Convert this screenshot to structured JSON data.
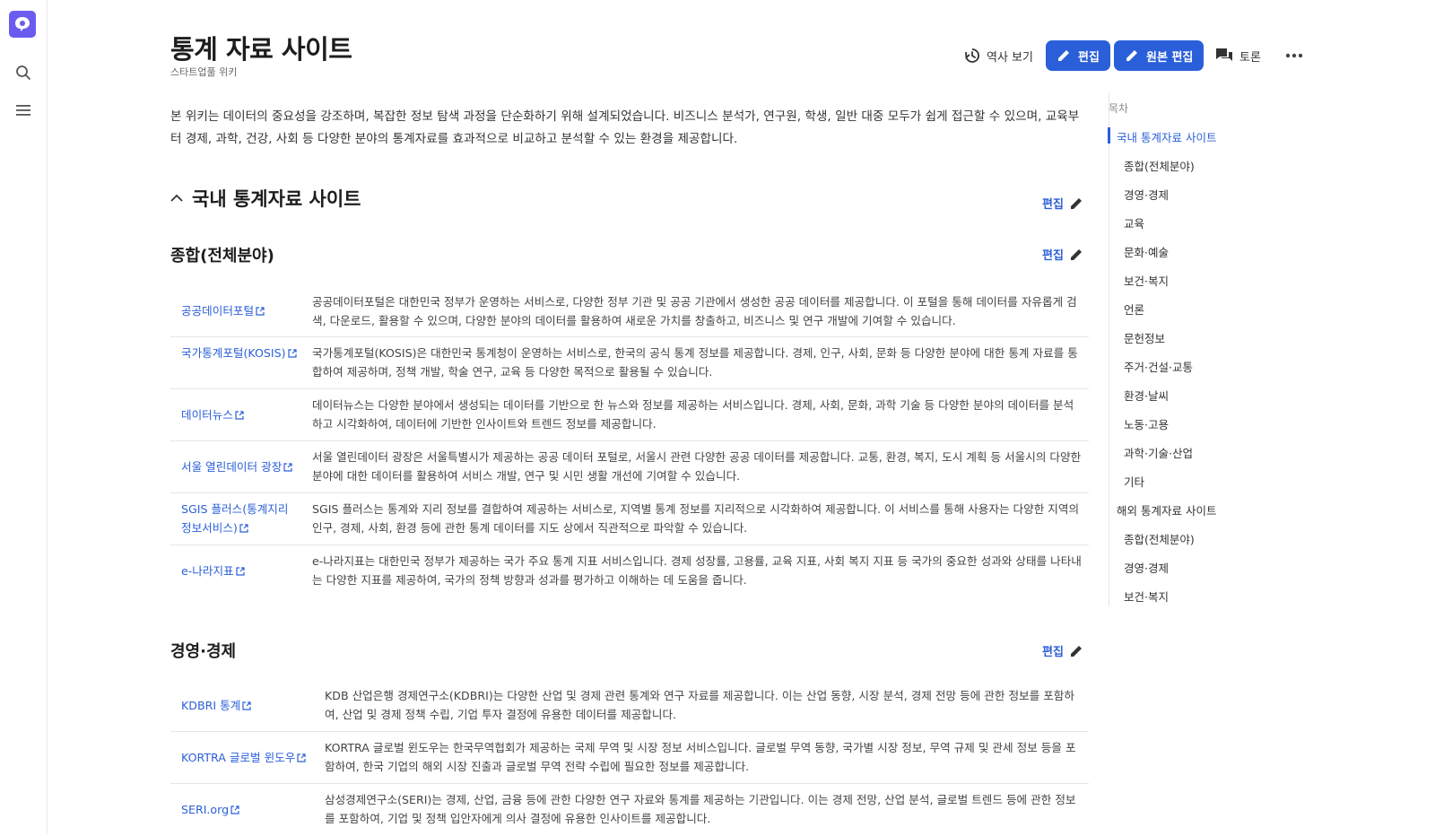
{
  "app": {
    "accent": "#2b5fd9",
    "logo_color": "#6b5cf0"
  },
  "rail": {
    "icons": [
      "logo-icon",
      "search-icon",
      "menu-icon"
    ]
  },
  "page": {
    "title": "통계 자료 사이트",
    "subtitle": "스타트업풀 위키"
  },
  "toolbar": {
    "history": "역사 보기",
    "edit": "편집",
    "source_edit": "원본 편집",
    "talk": "토론"
  },
  "intro": "본 위키는 데이터의 중요성을 강조하며, 복잡한 정보 탐색 과정을 단순화하기 위해 설계되었습니다. 비즈니스 분석가, 연구원, 학생, 일반 대중 모두가 쉽게 접근할 수 있으며, 교육부터 경제, 과학, 건강, 사회 등 다양한 분야의 통계자료를 효과적으로 비교하고 분석할 수 있는 환경을 제공합니다.",
  "section": {
    "title": "국내 통계자료 사이트",
    "edit": "편집"
  },
  "general": {
    "title": "종합(전체분야)",
    "edit": "편집",
    "rows": [
      {
        "name": "공공데이터포털",
        "desc": "공공데이터포털은 대한민국 정부가 운영하는 서비스로, 다양한 정부 기관 및 공공 기관에서 생성한 공공 데이터를 제공합니다. 이 포털을 통해 데이터를 자유롭게 검색, 다운로드, 활용할 수 있으며, 다양한 분야의 데이터를 활용하여 새로운 가치를 창출하고, 비즈니스 및 연구 개발에 기여할 수 있습니다."
      },
      {
        "name": "국가통계포털(KOSIS)",
        "desc": "국가통계포털(KOSIS)은 대한민국 통계청이 운영하는 서비스로, 한국의 공식 통계 정보를 제공합니다. 경제, 인구, 사회, 문화 등 다양한 분야에 대한 통계 자료를 통합하여 제공하며, 정책 개발, 학술 연구, 교육 등 다양한 목적으로 활용될 수 있습니다."
      },
      {
        "name": "데이터뉴스",
        "desc": "데이터뉴스는 다양한 분야에서 생성되는 데이터를 기반으로 한 뉴스와 정보를 제공하는 서비스입니다. 경제, 사회, 문화, 과학 기술 등 다양한 분야의 데이터를 분석하고 시각화하여, 데이터에 기반한 인사이트와 트렌드 정보를 제공합니다."
      },
      {
        "name": "서울 열린데이터 광장",
        "desc": "서울 열린데이터 광장은 서울특별시가 제공하는 공공 데이터 포털로, 서울시 관련 다양한 공공 데이터를 제공합니다. 교통, 환경, 복지, 도시 계획 등 서울시의 다양한 분야에 대한 데이터를 활용하여 서비스 개발, 연구 및 시민 생활 개선에 기여할 수 있습니다."
      },
      {
        "name": "SGIS 플러스(통계지리정보서비스)",
        "desc": "SGIS 플러스는 통계와 지리 정보를 결합하여 제공하는 서비스로, 지역별 통계 정보를 지리적으로 시각화하여 제공합니다. 이 서비스를 통해 사용자는 다양한 지역의 인구, 경제, 사회, 환경 등에 관한 통계 데이터를 지도 상에서 직관적으로 파악할 수 있습니다."
      },
      {
        "name": "e-나라지표",
        "desc": "e-나라지표는 대한민국 정부가 제공하는 국가 주요 통계 지표 서비스입니다. 경제 성장률, 고용률, 교육 지표, 사회 복지 지표 등 국가의 중요한 성과와 상태를 나타내는 다양한 지표를 제공하여, 국가의 정책 방향과 성과를 평가하고 이해하는 데 도움을 줍니다."
      }
    ]
  },
  "economy": {
    "title": "경영·경제",
    "edit": "편집",
    "rows": [
      {
        "name": "KDBRI 통계",
        "desc": "KDB 산업은행 경제연구소(KDBRI)는 다양한 산업 및 경제 관련 통계와 연구 자료를 제공합니다. 이는 산업 동향, 시장 분석, 경제 전망 등에 관한 정보를 포함하여, 산업 및 경제 정책 수립, 기업 투자 결정에 유용한 데이터를 제공합니다."
      },
      {
        "name": "KORTRA 글로벌 윈도우",
        "desc": "KORTRA 글로벌 윈도우는 한국무역협회가 제공하는 국제 무역 및 시장 정보 서비스입니다. 글로벌 무역 동향, 국가별 시장 정보, 무역 규제 및 관세 정보 등을 포함하여, 한국 기업의 해외 시장 진출과 글로벌 무역 전략 수립에 필요한 정보를 제공합니다."
      },
      {
        "name": "SERI.org",
        "desc": "삼성경제연구소(SERI)는 경제, 산업, 금융 등에 관한 다양한 연구 자료와 통계를 제공하는 기관입니다. 이는 경제 전망, 산업 분석, 글로벌 트렌드 등에 관한 정보를 포함하여, 기업 및 정책 입안자에게 의사 결정에 유용한 인사이트를 제공합니다."
      }
    ]
  },
  "toc": {
    "title": "목차",
    "items": [
      {
        "label": "국내 통계자료 사이트",
        "level": 1,
        "active": true
      },
      {
        "label": "종합(전체분야)",
        "level": 2
      },
      {
        "label": "경영·경제",
        "level": 2
      },
      {
        "label": "교육",
        "level": 2
      },
      {
        "label": "문화·예술",
        "level": 2
      },
      {
        "label": "보건·복지",
        "level": 2
      },
      {
        "label": "언론",
        "level": 2
      },
      {
        "label": "문헌정보",
        "level": 2
      },
      {
        "label": "주거·건설·교통",
        "level": 2
      },
      {
        "label": "환경·날씨",
        "level": 2
      },
      {
        "label": "노동·고용",
        "level": 2
      },
      {
        "label": "과학·기술·산업",
        "level": 2
      },
      {
        "label": "기타",
        "level": 2
      },
      {
        "label": "해외 통계자료 사이트",
        "level": 1
      },
      {
        "label": "종합(전체분야)",
        "level": 2
      },
      {
        "label": "경영·경제",
        "level": 2
      },
      {
        "label": "보건·복지",
        "level": 2
      }
    ]
  }
}
